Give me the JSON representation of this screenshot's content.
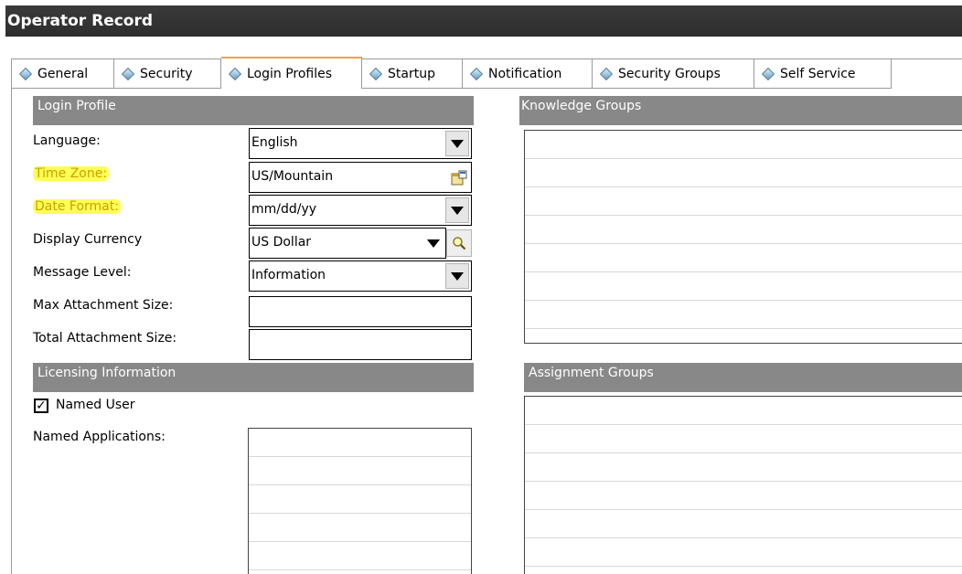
{
  "window": {
    "title": "Operator Record"
  },
  "tabs": [
    {
      "label": "General"
    },
    {
      "label": "Security"
    },
    {
      "label": "Login Profiles"
    },
    {
      "label": "Startup"
    },
    {
      "label": "Notification"
    },
    {
      "label": "Security Groups"
    },
    {
      "label": "Self Service"
    }
  ],
  "active_tab": "Login Profiles",
  "login_profile": {
    "header": "Login Profile",
    "language_label": "Language:",
    "language_value": "English",
    "timezone_label": "Time Zone:",
    "timezone_value": "US/Mountain",
    "date_format_label": "Date Format:",
    "date_format_value": "mm/dd/yy",
    "currency_label": "Display Currency",
    "currency_value": "US Dollar",
    "message_level_label": "Message Level:",
    "message_level_value": "Information",
    "max_attach_label": "Max Attachment Size:",
    "max_attach_value": "",
    "total_attach_label": "Total Attachment Size:",
    "total_attach_value": ""
  },
  "licensing": {
    "header": "Licensing Information",
    "named_user_label": "Named User",
    "named_user_checked": true,
    "named_apps_label": "Named Applications:"
  },
  "knowledge_groups": {
    "header": "Knowledge Groups"
  },
  "assignment_groups": {
    "header": "Assignment Groups"
  },
  "colors": {
    "titlebar": "#2e2e2e",
    "section_header": "#888888",
    "highlight": "#ffff55",
    "active_tab_accent": "#f0a050"
  },
  "icons": {
    "tab": "diamond-icon",
    "timezone": "calendar-picker-icon",
    "currency_lookup": "magnifier-icon"
  }
}
